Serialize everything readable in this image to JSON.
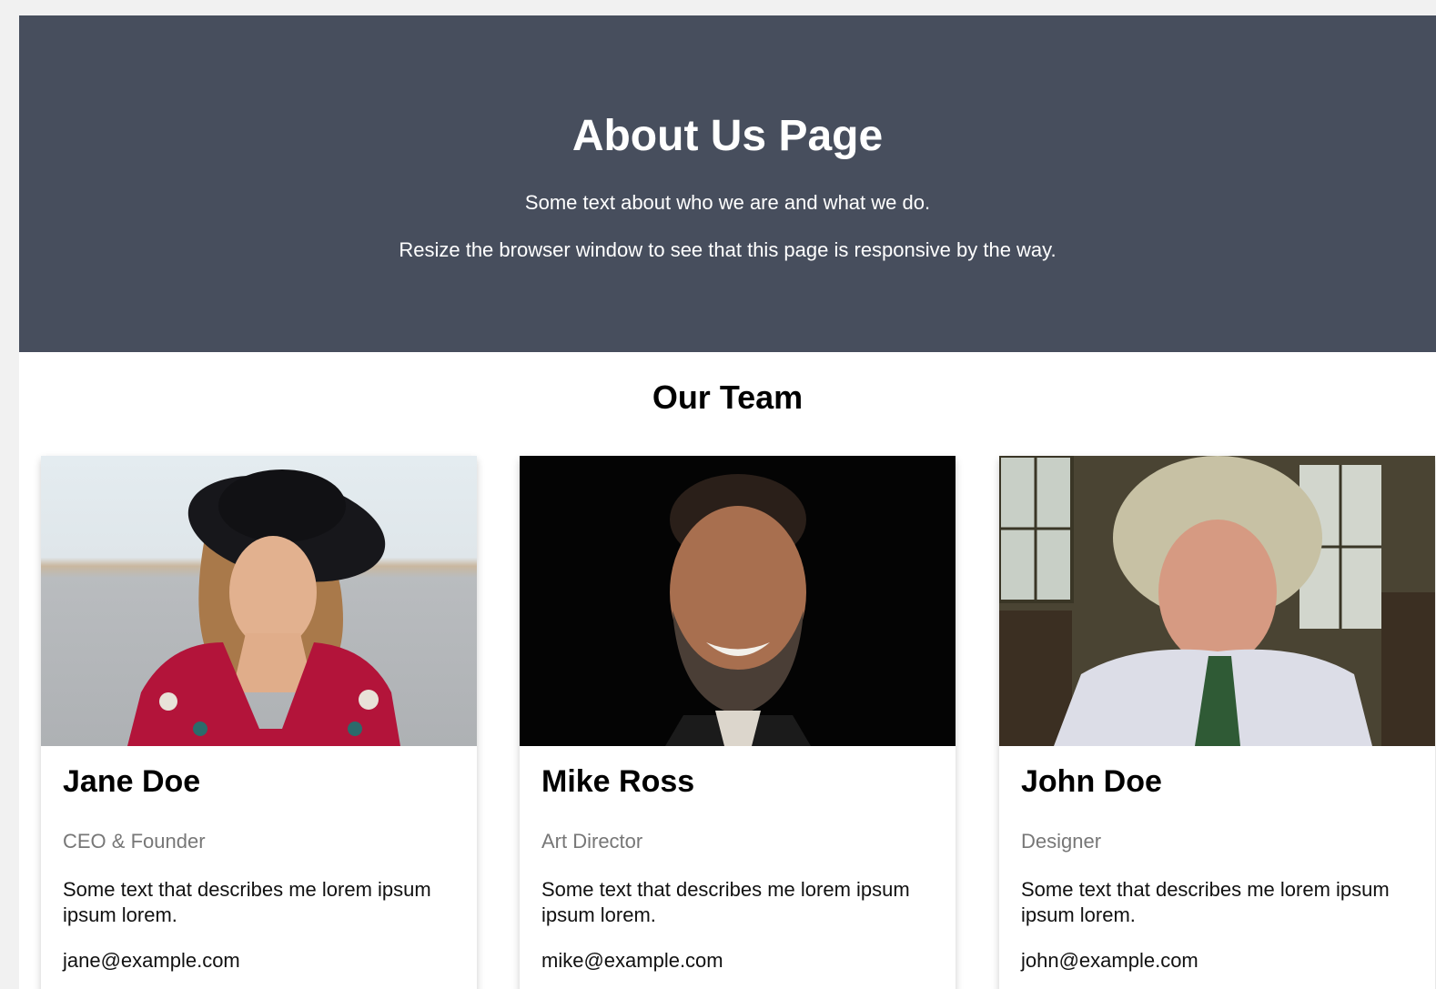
{
  "hero": {
    "title": "About Us Page",
    "line1": "Some text about who we are and what we do.",
    "line2": "Resize the browser window to see that this page is responsive by the way.",
    "background": "#474e5d"
  },
  "team": {
    "title": "Our Team",
    "members": [
      {
        "name": "Jane Doe",
        "role": "CEO & Founder",
        "description": "Some text that describes me lorem ipsum ipsum lorem.",
        "email": "jane@example.com"
      },
      {
        "name": "Mike Ross",
        "role": "Art Director",
        "description": "Some text that describes me lorem ipsum ipsum lorem.",
        "email": "mike@example.com"
      },
      {
        "name": "John Doe",
        "role": "Designer",
        "description": "Some text that describes me lorem ipsum ipsum lorem.",
        "email": "john@example.com"
      }
    ]
  }
}
